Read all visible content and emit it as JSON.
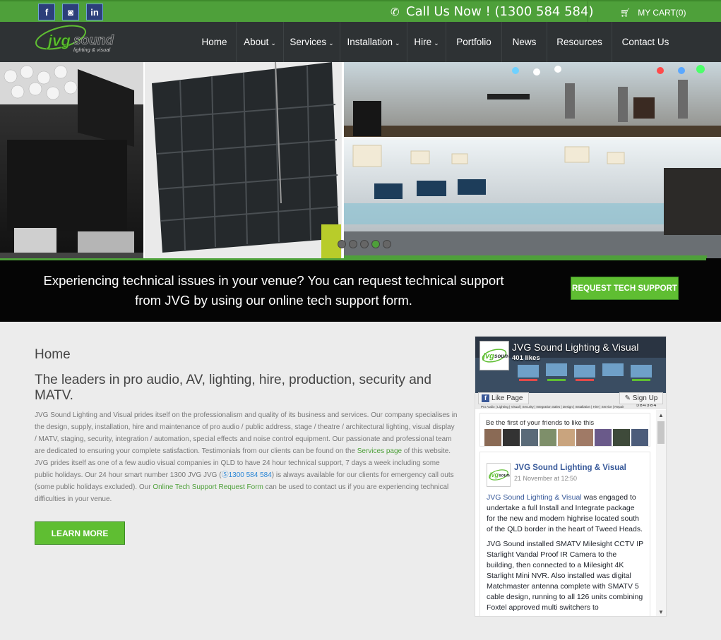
{
  "topbar": {
    "social": [
      {
        "name": "facebook-icon",
        "glyph": "f"
      },
      {
        "name": "instagram-icon",
        "glyph": "◙"
      },
      {
        "name": "linkedin-icon",
        "glyph": "in"
      }
    ],
    "call_text": "Call Us Now ! (1300 584 584)",
    "cart_label": "MY CART(0)"
  },
  "logo": {
    "wordmark": "jvgsound",
    "tagline": "lighting & visual"
  },
  "nav": {
    "items": [
      {
        "label": "Home",
        "dropdown": false
      },
      {
        "label": "About",
        "dropdown": true
      },
      {
        "label": "Services",
        "dropdown": true
      },
      {
        "label": "Installation",
        "dropdown": true
      },
      {
        "label": "Hire",
        "dropdown": true
      },
      {
        "label": "Portfolio",
        "dropdown": false
      },
      {
        "label": "News",
        "dropdown": false
      },
      {
        "label": "Resources",
        "dropdown": false
      },
      {
        "label": "Contact Us",
        "dropdown": false
      }
    ],
    "chevron": "⌄"
  },
  "slider": {
    "slide_count": 5,
    "active_index": 3
  },
  "banner": {
    "text": "Experiencing technical issues in your venue? You can request technical support from JVG by using our online tech support form.",
    "button_label": "REQUEST TECH SUPPORT"
  },
  "main": {
    "heading": "Home",
    "subheading": "The leaders in pro audio, AV, lighting, hire, production, security and MATV.",
    "body_part1": "JVG Sound Lighting and Visual prides itself on the professionalism and quality of its business and services. Our company specialises in the design, supply, installation, hire and maintenance of pro audio / public address, stage / theatre / architectural lighting, visual display / MATV, staging, security, integration / automation, special effects and noise control equipment. Our passionate and professional team are dedicated to ensuring your complete satisfaction. Testimonials from our clients can be found on the ",
    "services_link": "Services page",
    "body_part2": " of this website. JVG prides itself as one of a few audio visual companies in QLD to have 24 hour technical support, 7 days a week including some public holidays. Our 24 hour smart number 1300 JVG JVG (",
    "phone_link": "1300 584 584",
    "body_part3": ") is always available for our clients for emergency call outs (some public holidays excluded). Our ",
    "support_link": "Online Tech Support Request Form",
    "body_part4": " can be used to contact us if you are experiencing technical difficulties in your venue.",
    "learn_more_label": "LEARN MORE"
  },
  "facebook": {
    "page_name": "JVG Sound Lighting & Visual",
    "likes": "401 likes",
    "like_button": "Like Page",
    "signup_button": "Sign Up",
    "cover_tagline": "Pro Audio | Lighting | Visual | Security | Integration   Sales | Design | Installation | Hire | Service | Repair",
    "cover_number": "584584",
    "friends_prompt": "Be the first of your friends to like this",
    "post": {
      "author": "JVG Sound Lighting & Visual",
      "date": "21 November at 12:50",
      "link_text": "JVG Sound Lighting & Visual",
      "para1_rest": " was engaged to undertake a full Install and Integrate package for the new and modern highrise located south of the QLD border in the heart of Tweed Heads.",
      "para2": "JVG Sound installed SMATV Milesight CCTV IP Starlight Vandal Proof IR Camera to the building, then connected to a Milesight 4K Starlight Mini NVR. Also installed was digital Matchmaster antenna complete with SMATV 5 cable design, running to all 126 units combining Foxtel approved multi switchers to"
    }
  },
  "colors": {
    "brand_green": "#4ea03a",
    "nav_dark": "#2e3234",
    "link_blue": "#2a86d6",
    "fb_blue": "#365899"
  }
}
